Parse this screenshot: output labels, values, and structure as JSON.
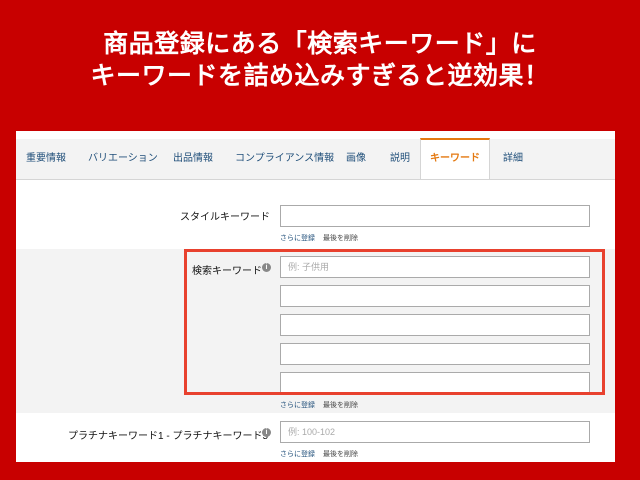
{
  "headline": {
    "line1": "商品登録にある「検索キーワード」に",
    "line2": "キーワードを詰め込みすぎると逆効果！"
  },
  "tabs": [
    {
      "label": "重要情報"
    },
    {
      "label": "バリエーション"
    },
    {
      "label": "出品情報"
    },
    {
      "label": "コンプライアンス情報"
    },
    {
      "label": "画像"
    },
    {
      "label": "説明"
    },
    {
      "label": "キーワード",
      "active": true
    },
    {
      "label": "詳細"
    }
  ],
  "style_keyword": {
    "label": "スタイルキーワード",
    "add_link": "さらに登録",
    "delete_link": "最後を削除"
  },
  "search_keyword": {
    "label": "検索キーワード",
    "info_icon": "i",
    "placeholder": "例: 子供用",
    "add_link": "さらに登録",
    "delete_link": "最後を削除"
  },
  "platinum_keyword": {
    "label": "プラチナキーワード1 - プラチナキーワード5",
    "info_icon": "i",
    "placeholder": "例: 100-102",
    "add_link": "さらに登録",
    "delete_link": "最後を削除"
  },
  "colors": {
    "background": "#c80000",
    "accent_tab": "#e47911",
    "highlight_border": "#e8412e",
    "link": "#1f4e79"
  }
}
